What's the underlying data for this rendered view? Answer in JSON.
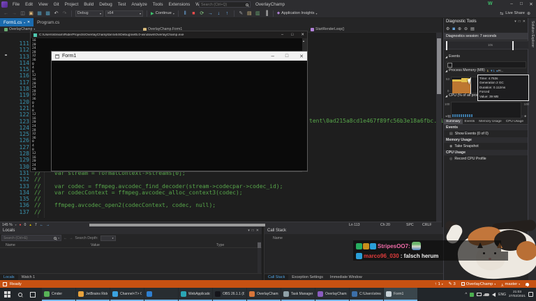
{
  "window": {
    "title": "OverlayChamp",
    "menu": [
      "File",
      "Edit",
      "View",
      "Git",
      "Project",
      "Build",
      "Debug",
      "Test",
      "Analyze",
      "Tools",
      "Extensions",
      "Window",
      "Help"
    ],
    "search_placeholder": "Search (Ctrl+Q)",
    "avatar_initial": "W",
    "minimize": "–",
    "maximize": "□",
    "close": "✕"
  },
  "toolbar": {
    "group1": [
      {
        "name": "nav-back-icon",
        "glyph": "←",
        "color": "#6e6e6e"
      },
      {
        "name": "nav-forward-icon",
        "glyph": "→",
        "color": "#585858"
      },
      {
        "name": "new-window-icon",
        "glyph": "◫",
        "color": "#8a8a8a"
      },
      {
        "name": "open-folder-icon",
        "glyph": "▣",
        "color": "#dcb67a"
      },
      {
        "name": "save-icon",
        "glyph": "▦",
        "color": "#519aba"
      },
      {
        "name": "save-all-icon",
        "glyph": "▩",
        "color": "#519aba"
      },
      {
        "name": "undo-icon",
        "glyph": "↶",
        "color": "#c8c8c8"
      },
      {
        "name": "redo-icon",
        "glyph": "↷",
        "color": "#5f5f5f"
      }
    ],
    "config_value": "Debug",
    "platform_value": "x64",
    "continue_label": "Continue",
    "group2": [
      {
        "name": "break-all-icon",
        "glyph": "‖",
        "color": "#75beff"
      },
      {
        "name": "stop-icon",
        "glyph": "■",
        "color": "#f14c4c"
      },
      {
        "name": "restart-icon",
        "glyph": "⟳",
        "color": "#89d185"
      },
      {
        "name": "show-next-statement-icon",
        "glyph": "→",
        "color": "#75beff"
      },
      {
        "name": "step-into-icon",
        "glyph": "↓",
        "color": "#75beff"
      },
      {
        "name": "step-out-icon",
        "glyph": "↑",
        "color": "#75beff"
      }
    ],
    "group3": [
      {
        "name": "pencil-icon",
        "glyph": "✎",
        "color": "#a0a0a0"
      },
      {
        "name": "doc-outline-icon",
        "glyph": "▤",
        "color": "#d7ba7d"
      },
      {
        "name": "doc-list-icon",
        "glyph": "▥",
        "color": "#6aab73"
      },
      {
        "name": "column-guide-icon",
        "glyph": "▐",
        "color": "#9a9a9a"
      }
    ],
    "app_insights_label": "Application Insights",
    "live_share_label": "Live Share"
  },
  "tabs": {
    "tab1": "Form1.cs",
    "tab2": "Program.cs",
    "close": "✕",
    "pin": "▪"
  },
  "navbar": {
    "project": "OverlayChamp",
    "type": "OverlayChamp.Form1",
    "member": "StartRenderLoop()"
  },
  "editor": {
    "line_numbers": [
      "111",
      "112",
      "113",
      "114",
      "115",
      "116",
      "117",
      "118",
      "119",
      "120",
      "121",
      "122",
      "123",
      "124",
      "125",
      "126",
      "127",
      "128",
      "129",
      "130",
      "131",
      "132",
      "133",
      "134",
      "135",
      "136",
      "137"
    ],
    "line123_fragment": "tent\\0ad215a8cd1e467f89fc56b3e18a6fbc.gif\";",
    "visible_code": [
      "//    var stream = formatContext->streams[0];",
      "//",
      "//    var codec = ffmpeg.avcodec_find_decoder(stream->codecpar->codec_id);",
      "//    var codecContext = ffmpeg.avcodec_alloc_context3(codec);",
      "//",
      "//    ffmpeg.avcodec_open2(codecContext, codec, null);",
      "//"
    ],
    "zoom": "145 %",
    "errors": "0",
    "warnings": "7",
    "ln": "Ln 113",
    "ch": "Ch 20",
    "spc": "SPC",
    "eol": "CRLF"
  },
  "console": {
    "title": "C:\\Users\\stream\\RiderProjects\\OverlayChamp\\bin\\x64\\Debug\\net5.0-windows\\OverlayChamp.exe",
    "minimize": "–",
    "maximize": "□",
    "close": "✕",
    "output": [
      "16",
      "20",
      "24",
      "28",
      "32",
      "36",
      "0",
      "4",
      "8",
      "12",
      "16",
      "20",
      "24",
      "28",
      "32",
      "36",
      "0",
      "4",
      "8",
      "12",
      "16",
      "20",
      "24",
      "28",
      "32",
      "36",
      "0",
      "4",
      "8",
      "12",
      "16",
      "20",
      "24",
      "28"
    ]
  },
  "form": {
    "title": "Form1",
    "minimize": "–",
    "maximize": "□",
    "close": "✕"
  },
  "diagnostics": {
    "title": "Diagnostic Tools",
    "toolbar_icons": [
      {
        "name": "settings-gear-icon",
        "glyph": "⚙",
        "color": "#c5c5c5"
      },
      {
        "name": "select-tools-icon",
        "glyph": "◙",
        "color": "#75beff"
      },
      {
        "name": "zoom-in-icon",
        "glyph": "⊕",
        "color": "#c5c5c5"
      },
      {
        "name": "zoom-out-icon",
        "glyph": "⊖",
        "color": "#c5c5c5"
      },
      {
        "name": "export-icon",
        "glyph": "▤",
        "color": "#c5c5c5"
      }
    ],
    "session_label": "Diagnostics session: 7 seconds",
    "ruler_tick": "10s",
    "events_section": "Events",
    "memory_section": "Process Memory (MB)",
    "cpu_section": "CPU (% of all processors)",
    "legend_count": "1",
    "legend_filter": "1",
    "legend_process": "Pr...",
    "memory_max": "53",
    "memory_min": "0",
    "cpu_max": "100",
    "cpu_min": "0",
    "tooltip": {
      "time": "Time: 4.753s",
      "gc": "Generation 2 GC",
      "duration": "Duration: 0.112ms",
      "forced": "Forced",
      "value": "Value: 39 MB"
    },
    "tabs": [
      {
        "label": "Summary",
        "active": true
      },
      {
        "label": "Events"
      },
      {
        "label": "Memory Usage"
      },
      {
        "label": "CPU Usage"
      }
    ],
    "events_header": "Events",
    "show_events_label": "Show Events (0 of 0)",
    "memory_header": "Memory Usage",
    "take_snapshot_label": "Take Snapshot",
    "cpu_header": "CPU Usage",
    "record_cpu_label": "Record CPU Profile"
  },
  "rail_label": "Solution Explorer",
  "locals": {
    "title": "Locals",
    "search_placeholder": "Search (Ctrl+E)",
    "search_depth_label": "Search Depth:",
    "columns": [
      "Name",
      "Value",
      "Type"
    ],
    "tab1": "Locals",
    "tab2": "Watch 1"
  },
  "callstack": {
    "title": "Call Stack",
    "column": "Name",
    "tab1": "Call Stack",
    "tab2": "Exception Settings",
    "tab3": "Immediate Window"
  },
  "statusbar": {
    "ready": "Ready",
    "outgoing_commits": "1",
    "pending_edits": "3",
    "repo": "OverlayChamp",
    "branch": "master"
  },
  "taskbar": {
    "items": [
      {
        "label": "Cmder",
        "color": "#58b457"
      },
      {
        "label": "JetBrains Rider 2...",
        "color": "#e8a33d"
      },
      {
        "label": "Channel<T> Cla...",
        "color": "#3ba3e0"
      },
      {
        "label": "",
        "color": "#2e7fd0",
        "icon_only": true
      },
      {
        "label": "WebApplication...",
        "color": "#2aa6b5"
      },
      {
        "label": "OBS 26.1.1 (64-b...",
        "color": "#14141a"
      },
      {
        "label": "OverlayChamp ~...",
        "color": "#d8763a"
      },
      {
        "label": "Task Manager",
        "color": "#8fa1a8"
      },
      {
        "label": "OverlayChamp (...",
        "color": "#8a5cc0"
      },
      {
        "label": "C:\\Users\\stream...",
        "color": "#3c6fa8"
      },
      {
        "label": "Form1",
        "color": "#c8d2d8",
        "active": true
      }
    ],
    "tray": {
      "lang": "ENG",
      "time": "21:03",
      "date": "27/02/2021"
    }
  },
  "chat": {
    "messages": [
      {
        "user": "StripesOO7:",
        "color": "#f06ba8",
        "text": "",
        "badges": [
          "#27ae60",
          "#c9901c",
          "#2a9fd8"
        ],
        "has_emote": true
      },
      {
        "user": "marco96_030",
        "color": "#e23c3c",
        "text": ": falsch herum",
        "badges": [
          "#2a9fd8"
        ]
      }
    ]
  }
}
